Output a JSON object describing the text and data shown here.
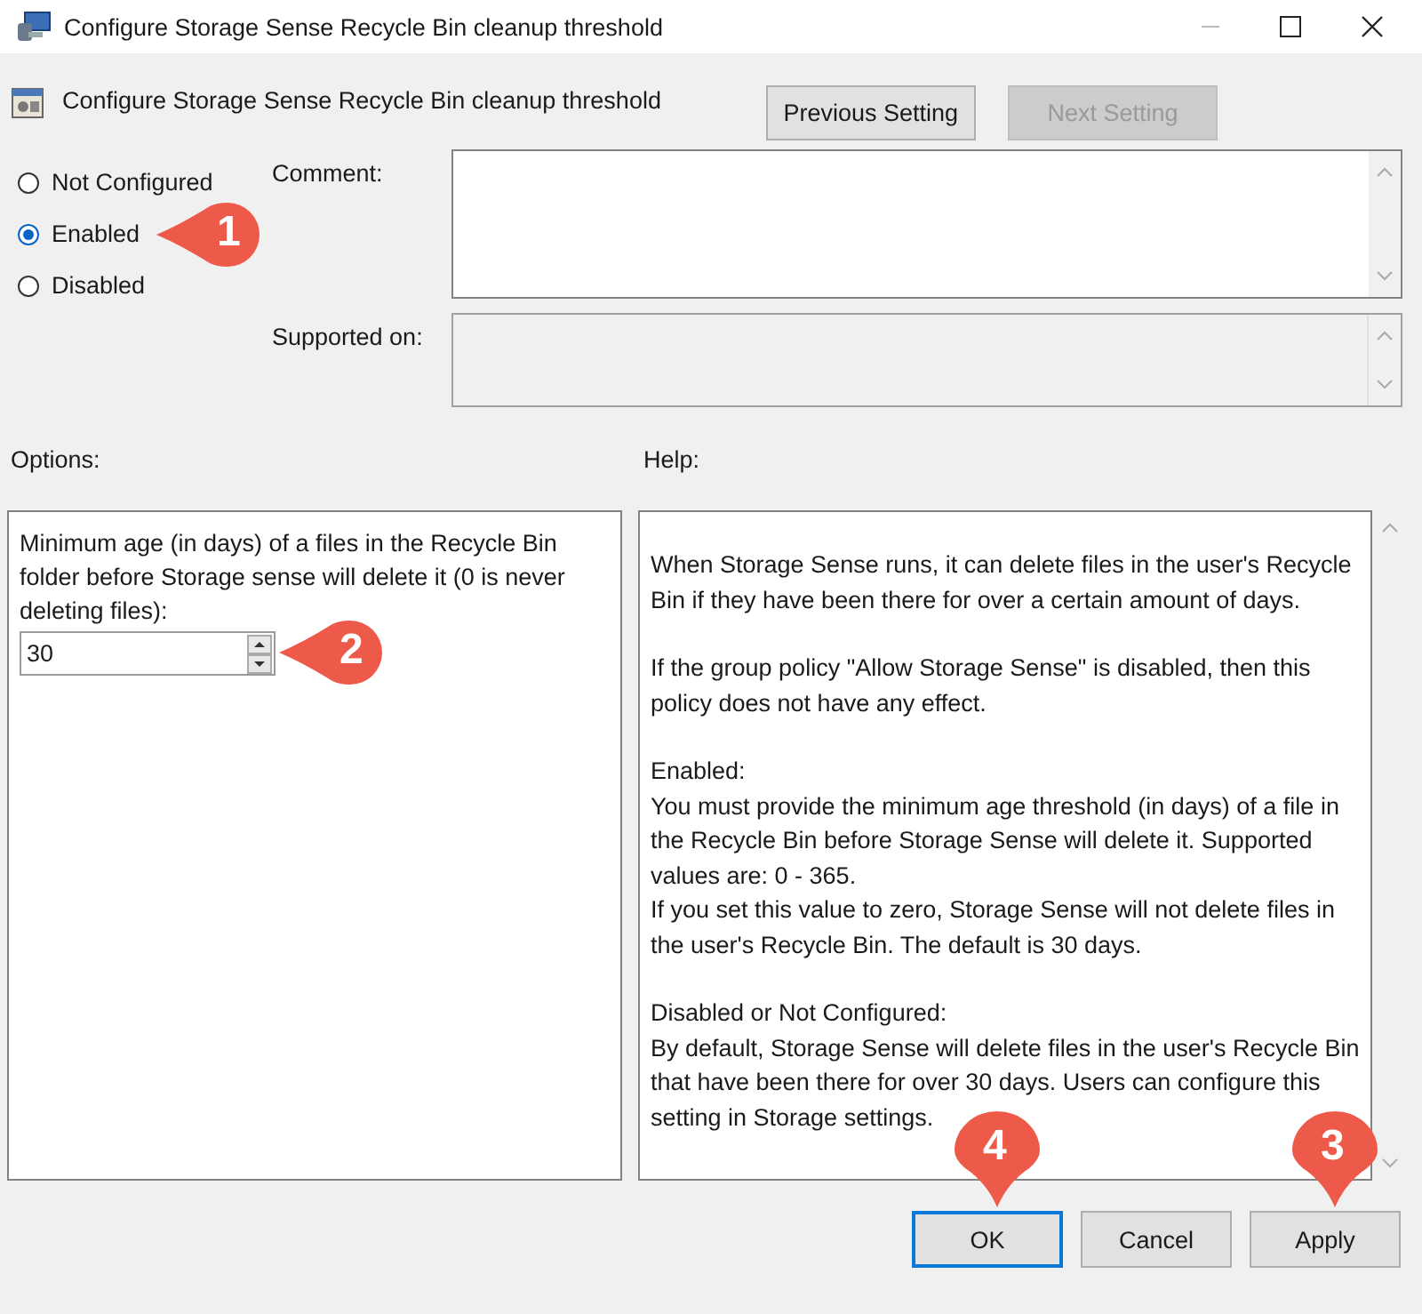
{
  "window": {
    "title": "Configure Storage Sense Recycle Bin cleanup threshold"
  },
  "header": {
    "title": "Configure Storage Sense Recycle Bin cleanup threshold"
  },
  "nav_buttons": [
    {
      "label": "Previous Setting",
      "disabled": false
    },
    {
      "label": "Next Setting",
      "disabled": true
    }
  ],
  "states": [
    {
      "label": "Not Configured",
      "selected": false
    },
    {
      "label": "Enabled",
      "selected": true,
      "callout": "1"
    },
    {
      "label": "Disabled",
      "selected": false
    }
  ],
  "comment": {
    "label": "Comment:"
  },
  "supported_on": {
    "label": "Supported on:"
  },
  "options": {
    "label": "Options:",
    "description": "Minimum age (in days) of a files in the Recycle Bin folder before Storage sense will delete it (0 is never deleting files):",
    "value": "30",
    "callout": "2"
  },
  "help": {
    "label": "Help:",
    "blocks": [
      [
        "When Storage Sense runs, it can delete files in the user's Recycle Bin if they have been there for over a certain amount of days."
      ],
      [
        "If the group policy \"Allow Storage Sense\" is disabled, then this policy does not have any effect."
      ],
      [
        "Enabled:",
        "You must provide the minimum age threshold (in days) of a file in the Recycle Bin before Storage Sense will delete it. Supported values are: 0 - 365.",
        "If you set this value to zero, Storage Sense will not delete files in the user's Recycle Bin. The default is 30 days."
      ],
      [
        "Disabled or Not Configured:",
        "By default, Storage Sense will delete files in the user's Recycle Bin that have been there for over 30 days. Users can configure this setting in Storage settings."
      ]
    ]
  },
  "buttons": [
    {
      "label": "OK",
      "focused": true,
      "callout": "4"
    },
    {
      "label": "Cancel",
      "focused": false
    },
    {
      "label": "Apply",
      "focused": false,
      "callout": "3"
    }
  ]
}
